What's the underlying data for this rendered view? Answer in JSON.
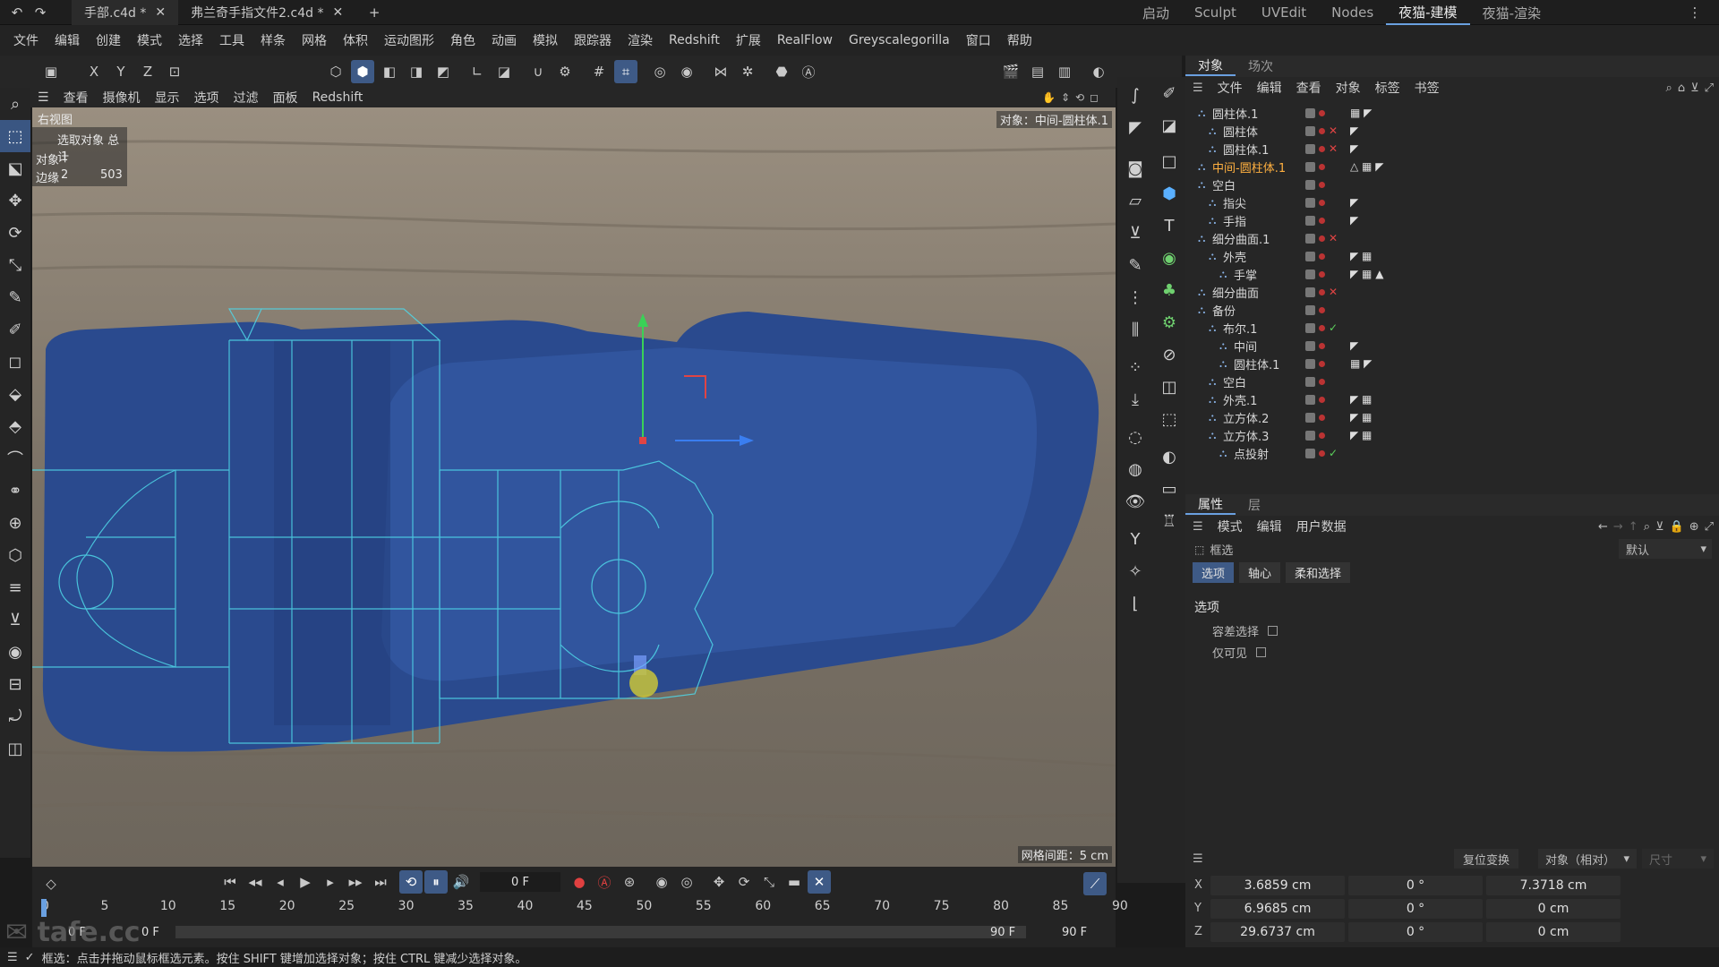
{
  "titlebar": {
    "tabs": [
      {
        "label": "手部.c4d *",
        "active": true
      },
      {
        "label": "弗兰奇手指文件2.c4d *",
        "active": false
      }
    ],
    "layouts": [
      "启动",
      "Sculpt",
      "UVEdit",
      "Nodes",
      "夜猫-建模",
      "夜猫-渲染"
    ],
    "active_layout": "夜猫-建模"
  },
  "menubar": [
    "文件",
    "编辑",
    "创建",
    "模式",
    "选择",
    "工具",
    "样条",
    "网格",
    "体积",
    "运动图形",
    "角色",
    "动画",
    "模拟",
    "跟踪器",
    "渲染",
    "Redshift",
    "扩展",
    "RealFlow",
    "Greyscalegorilla",
    "窗口",
    "帮助"
  ],
  "toolbar": {
    "axes": [
      "X",
      "Y",
      "Z"
    ]
  },
  "viewport": {
    "menu": [
      "查看",
      "摄像机",
      "显示",
      "选项",
      "过滤",
      "面板",
      "Redshift"
    ],
    "view_name": "右视图",
    "object_label": "对象：中间-圆柱体.1",
    "stats_header": "选取对象 总计",
    "stats": [
      {
        "label": "对象",
        "selected": "1",
        "total": ""
      },
      {
        "label": "边缘",
        "selected": "2",
        "total": "503"
      }
    ],
    "grid_spacing": "网格间距：5 cm"
  },
  "object_manager": {
    "tabs": [
      "对象",
      "场次"
    ],
    "menu": [
      "文件",
      "编辑",
      "查看",
      "对象",
      "标签",
      "书签"
    ],
    "objects": [
      {
        "name": "圆柱体.1",
        "indent": 0,
        "x": false,
        "check": false,
        "tag": "▦ ◤"
      },
      {
        "name": "圆柱体",
        "indent": 1,
        "x": true,
        "check": false,
        "tag": "◤"
      },
      {
        "name": "圆柱体.1",
        "indent": 1,
        "x": true,
        "check": false,
        "tag": "◤"
      },
      {
        "name": "中间-圆柱体.1",
        "indent": 0,
        "x": false,
        "check": false,
        "tag": "△ ▦ ◤",
        "highlight": true
      },
      {
        "name": "空白",
        "indent": 0,
        "x": false,
        "check": false,
        "tag": ""
      },
      {
        "name": "指尖",
        "indent": 1,
        "x": false,
        "check": false,
        "tag": "◤"
      },
      {
        "name": "手指",
        "indent": 1,
        "x": false,
        "check": false,
        "tag": "◤"
      },
      {
        "name": "细分曲面.1",
        "indent": 0,
        "x": true,
        "check": false,
        "tag": ""
      },
      {
        "name": "外壳",
        "indent": 1,
        "x": false,
        "check": false,
        "tag": "◤ ▦"
      },
      {
        "name": "手掌",
        "indent": 2,
        "x": false,
        "check": false,
        "tag": "◤ ▦ ▲"
      },
      {
        "name": "细分曲面",
        "indent": 0,
        "x": true,
        "check": false,
        "tag": ""
      },
      {
        "name": "备份",
        "indent": 0,
        "x": false,
        "check": false,
        "tag": ""
      },
      {
        "name": "布尔.1",
        "indent": 1,
        "x": false,
        "check": true,
        "tag": ""
      },
      {
        "name": "中间",
        "indent": 2,
        "x": false,
        "check": false,
        "tag": "◤"
      },
      {
        "name": "圆柱体.1",
        "indent": 2,
        "x": false,
        "check": false,
        "tag": "▦ ◤"
      },
      {
        "name": "空白",
        "indent": 1,
        "x": false,
        "check": false,
        "tag": ""
      },
      {
        "name": "外壳.1",
        "indent": 1,
        "x": false,
        "check": false,
        "tag": "◤ ▦"
      },
      {
        "name": "立方体.2",
        "indent": 1,
        "x": false,
        "check": false,
        "tag": "◤ ▦"
      },
      {
        "name": "立方体.3",
        "indent": 1,
        "x": false,
        "check": false,
        "tag": "◤ ▦"
      },
      {
        "name": "点投射",
        "indent": 2,
        "x": false,
        "check": true,
        "tag": ""
      }
    ]
  },
  "attributes": {
    "tabs": [
      "属性",
      "层"
    ],
    "menu": [
      "模式",
      "编辑",
      "用户数据"
    ],
    "tool_name": "框选",
    "preset": "默认",
    "subtabs": [
      "选项",
      "轴心",
      "柔和选择"
    ],
    "section": "选项",
    "options": [
      "容差选择",
      "仅可见"
    ]
  },
  "coords": {
    "reset_label": "复位变换",
    "mode": "对象（相对）",
    "size_label": "尺寸",
    "rows": [
      {
        "axis": "X",
        "pos": "3.6859 cm",
        "rot": "0 °",
        "size": "7.3718 cm"
      },
      {
        "axis": "Y",
        "pos": "6.9685 cm",
        "rot": "0 °",
        "size": "0 cm"
      },
      {
        "axis": "Z",
        "pos": "29.6737 cm",
        "rot": "0 °",
        "size": "0 cm"
      }
    ]
  },
  "timeline": {
    "current_frame": "0 F",
    "ticks": [
      "0",
      "5",
      "10",
      "15",
      "20",
      "25",
      "30",
      "35",
      "40",
      "45",
      "50",
      "55",
      "60",
      "65",
      "70",
      "75",
      "80",
      "85",
      "90"
    ],
    "start": "0 F",
    "min": "0 F",
    "max": "90 F",
    "end": "90 F"
  },
  "status": "框选：点击并拖动鼠标框选元素。按住 SHIFT 键增加选择对象；按住 CTRL 键减少选择对象。",
  "watermark": "tafe.cc",
  "colors": {
    "accent": "#3e5a86",
    "object_blue": "#2a4a8e",
    "wire": "#4fd7e8",
    "highlight_orange": "#ffb040"
  }
}
